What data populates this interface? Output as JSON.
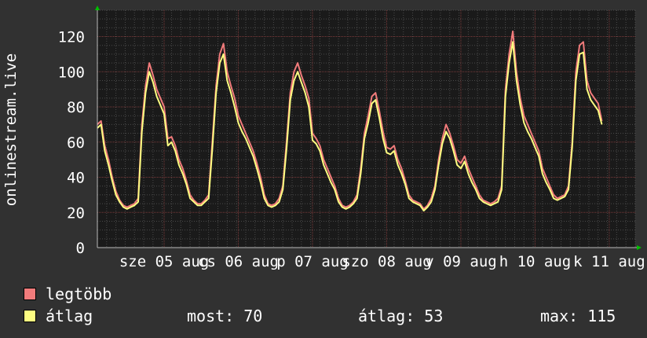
{
  "chart_data": {
    "type": "line",
    "title": "",
    "ylabel": "onlinestream.live",
    "xlabel": "",
    "ylim": [
      0,
      135
    ],
    "yticks": [
      0,
      20,
      40,
      60,
      80,
      100,
      120
    ],
    "grid": true,
    "x_tick_labels": [
      {
        "label": "sze 05 aug",
        "t": 0.9
      },
      {
        "label": "cs 06 aug",
        "t": 1.9
      },
      {
        "label": "p 07 aug",
        "t": 2.9
      },
      {
        "label": "szo 08 aug",
        "t": 3.9
      },
      {
        "label": "v 09 aug",
        "t": 4.9
      },
      {
        "label": "h 10 aug",
        "t": 5.9
      },
      {
        "label": "k 11 aug",
        "t": 6.9
      }
    ],
    "t_range": [
      0,
      7.25
    ],
    "series": [
      {
        "name": "legtöbb",
        "color": "#f17b7b",
        "t": [
          0.0,
          0.05,
          0.1,
          0.15,
          0.2,
          0.25,
          0.3,
          0.35,
          0.4,
          0.45,
          0.5,
          0.55,
          0.6,
          0.65,
          0.7,
          0.75,
          0.8,
          0.85,
          0.9,
          0.95,
          1.0,
          1.05,
          1.1,
          1.15,
          1.2,
          1.25,
          1.3,
          1.35,
          1.4,
          1.45,
          1.5,
          1.55,
          1.6,
          1.65,
          1.7,
          1.75,
          1.8,
          1.85,
          1.9,
          1.95,
          2.0,
          2.05,
          2.1,
          2.15,
          2.2,
          2.25,
          2.3,
          2.35,
          2.4,
          2.45,
          2.5,
          2.55,
          2.6,
          2.65,
          2.7,
          2.75,
          2.8,
          2.85,
          2.9,
          2.95,
          3.0,
          3.05,
          3.1,
          3.15,
          3.2,
          3.25,
          3.3,
          3.35,
          3.4,
          3.45,
          3.5,
          3.55,
          3.6,
          3.65,
          3.7,
          3.75,
          3.8,
          3.85,
          3.9,
          3.95,
          4.0,
          4.05,
          4.1,
          4.15,
          4.2,
          4.25,
          4.3,
          4.35,
          4.4,
          4.45,
          4.5,
          4.55,
          4.6,
          4.65,
          4.7,
          4.75,
          4.8,
          4.85,
          4.9,
          4.95,
          5.0,
          5.05,
          5.1,
          5.15,
          5.2,
          5.25,
          5.3,
          5.35,
          5.4,
          5.45,
          5.5,
          5.55,
          5.6,
          5.65,
          5.7,
          5.75,
          5.8,
          5.85,
          5.9,
          5.95,
          6.0,
          6.05,
          6.1,
          6.15,
          6.2,
          6.25,
          6.3,
          6.35,
          6.4,
          6.45,
          6.5,
          6.55,
          6.6,
          6.65,
          6.7,
          6.75,
          6.8,
          6.85,
          6.9,
          6.95,
          7.0,
          7.05,
          7.1
        ],
        "values": [
          70,
          72,
          58,
          50,
          40,
          32,
          27,
          24,
          23,
          24,
          25,
          28,
          70,
          92,
          105,
          98,
          90,
          85,
          80,
          62,
          63,
          58,
          50,
          45,
          38,
          30,
          27,
          25,
          25,
          27,
          30,
          60,
          92,
          110,
          116,
          100,
          92,
          85,
          75,
          70,
          65,
          60,
          55,
          48,
          40,
          30,
          25,
          24,
          25,
          28,
          35,
          60,
          88,
          100,
          105,
          98,
          92,
          85,
          65,
          62,
          58,
          50,
          45,
          40,
          35,
          28,
          24,
          23,
          24,
          26,
          30,
          45,
          65,
          75,
          86,
          88,
          78,
          66,
          57,
          56,
          58,
          50,
          45,
          38,
          30,
          27,
          26,
          25,
          22,
          24,
          28,
          35,
          50,
          62,
          70,
          65,
          58,
          50,
          48,
          52,
          45,
          40,
          35,
          30,
          27,
          26,
          25,
          26,
          28,
          35,
          90,
          110,
          123,
          100,
          85,
          75,
          70,
          65,
          60,
          55,
          45,
          40,
          35,
          30,
          28,
          29,
          30,
          35,
          60,
          100,
          115,
          117,
          95,
          88,
          85,
          82,
          72
        ],
        "max_hint": 123
      },
      {
        "name": "átlag",
        "color": "#fdfd81",
        "t": [
          0.0,
          0.05,
          0.1,
          0.15,
          0.2,
          0.25,
          0.3,
          0.35,
          0.4,
          0.45,
          0.5,
          0.55,
          0.6,
          0.65,
          0.7,
          0.75,
          0.8,
          0.85,
          0.9,
          0.95,
          1.0,
          1.05,
          1.1,
          1.15,
          1.2,
          1.25,
          1.3,
          1.35,
          1.4,
          1.45,
          1.5,
          1.55,
          1.6,
          1.65,
          1.7,
          1.75,
          1.8,
          1.85,
          1.9,
          1.95,
          2.0,
          2.05,
          2.1,
          2.15,
          2.2,
          2.25,
          2.3,
          2.35,
          2.4,
          2.45,
          2.5,
          2.55,
          2.6,
          2.65,
          2.7,
          2.75,
          2.8,
          2.85,
          2.9,
          2.95,
          3.0,
          3.05,
          3.1,
          3.15,
          3.2,
          3.25,
          3.3,
          3.35,
          3.4,
          3.45,
          3.5,
          3.55,
          3.6,
          3.65,
          3.7,
          3.75,
          3.8,
          3.85,
          3.9,
          3.95,
          4.0,
          4.05,
          4.1,
          4.15,
          4.2,
          4.25,
          4.3,
          4.35,
          4.4,
          4.45,
          4.5,
          4.55,
          4.6,
          4.65,
          4.7,
          4.75,
          4.8,
          4.85,
          4.9,
          4.95,
          5.0,
          5.05,
          5.1,
          5.15,
          5.2,
          5.25,
          5.3,
          5.35,
          5.4,
          5.45,
          5.5,
          5.55,
          5.6,
          5.65,
          5.7,
          5.75,
          5.8,
          5.85,
          5.9,
          5.95,
          6.0,
          6.05,
          6.1,
          6.15,
          6.2,
          6.25,
          6.3,
          6.35,
          6.4,
          6.45,
          6.5,
          6.55,
          6.6,
          6.65,
          6.7,
          6.75,
          6.8,
          6.85,
          6.9,
          6.95,
          7.0,
          7.05,
          7.1
        ],
        "values": [
          68,
          70,
          55,
          47,
          38,
          30,
          26,
          23,
          22,
          23,
          24,
          26,
          66,
          88,
          100,
          94,
          86,
          81,
          76,
          58,
          60,
          55,
          47,
          42,
          36,
          28,
          26,
          24,
          24,
          26,
          28,
          56,
          88,
          105,
          110,
          95,
          88,
          80,
          71,
          66,
          62,
          57,
          52,
          45,
          37,
          28,
          24,
          23,
          24,
          26,
          33,
          56,
          84,
          95,
          100,
          94,
          88,
          80,
          61,
          59,
          55,
          47,
          42,
          37,
          33,
          26,
          23,
          22,
          23,
          25,
          28,
          42,
          62,
          71,
          82,
          84,
          74,
          62,
          54,
          53,
          55,
          47,
          42,
          36,
          28,
          26,
          25,
          24,
          21,
          23,
          26,
          33,
          47,
          59,
          66,
          62,
          55,
          47,
          45,
          49,
          42,
          37,
          33,
          28,
          26,
          25,
          24,
          25,
          26,
          33,
          86,
          105,
          117,
          95,
          81,
          71,
          66,
          62,
          57,
          52,
          42,
          37,
          33,
          28,
          27,
          28,
          29,
          33,
          57,
          95,
          110,
          111,
          90,
          84,
          81,
          78,
          70
        ]
      }
    ],
    "legend": {
      "position": "bottom-left",
      "items": [
        {
          "label": "legtöbb",
          "color": "#f17b7b"
        },
        {
          "label": "átlag",
          "color": "#fdfd81"
        }
      ]
    },
    "stats": {
      "now": "most: 70",
      "avg": "átlag: 53",
      "max": "max: 115"
    }
  }
}
